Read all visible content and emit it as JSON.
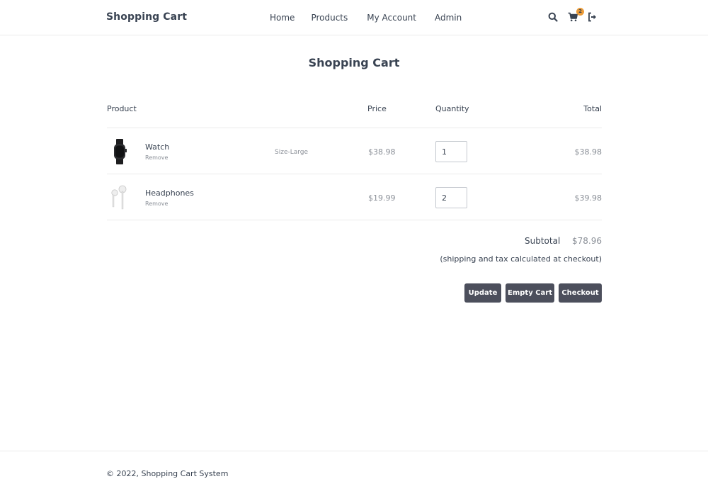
{
  "header": {
    "brand": "Shopping Cart",
    "nav": [
      "Home",
      "Products",
      "My Account",
      "Admin"
    ],
    "cart_count": "2",
    "icons": [
      "search-icon",
      "cart-icon",
      "logout-icon"
    ]
  },
  "page_title": "Shopping Cart",
  "table": {
    "headers": {
      "product": "Product",
      "price": "Price",
      "quantity": "Quantity",
      "total": "Total"
    },
    "rows": [
      {
        "name": "Watch",
        "remove": "Remove",
        "option": "Size-Large",
        "price": "$38.98",
        "quantity": "1",
        "total": "$38.98"
      },
      {
        "name": "Headphones",
        "remove": "Remove",
        "option": "",
        "price": "$19.99",
        "quantity": "2",
        "total": "$39.98"
      }
    ]
  },
  "summary": {
    "subtotal_label": "Subtotal",
    "subtotal_value": "$78.96",
    "note": "(shipping and tax calculated at checkout)"
  },
  "buttons": {
    "update": "Update",
    "empty": "Empty Cart",
    "checkout": "Checkout"
  },
  "footer": {
    "copyright": "© 2022, Shopping Cart System"
  },
  "colors": {
    "text": "#394352",
    "muted": "#8a8f97",
    "button": "#4c4f5c",
    "badge": "#eb9b38",
    "border": "#ebebeb"
  }
}
